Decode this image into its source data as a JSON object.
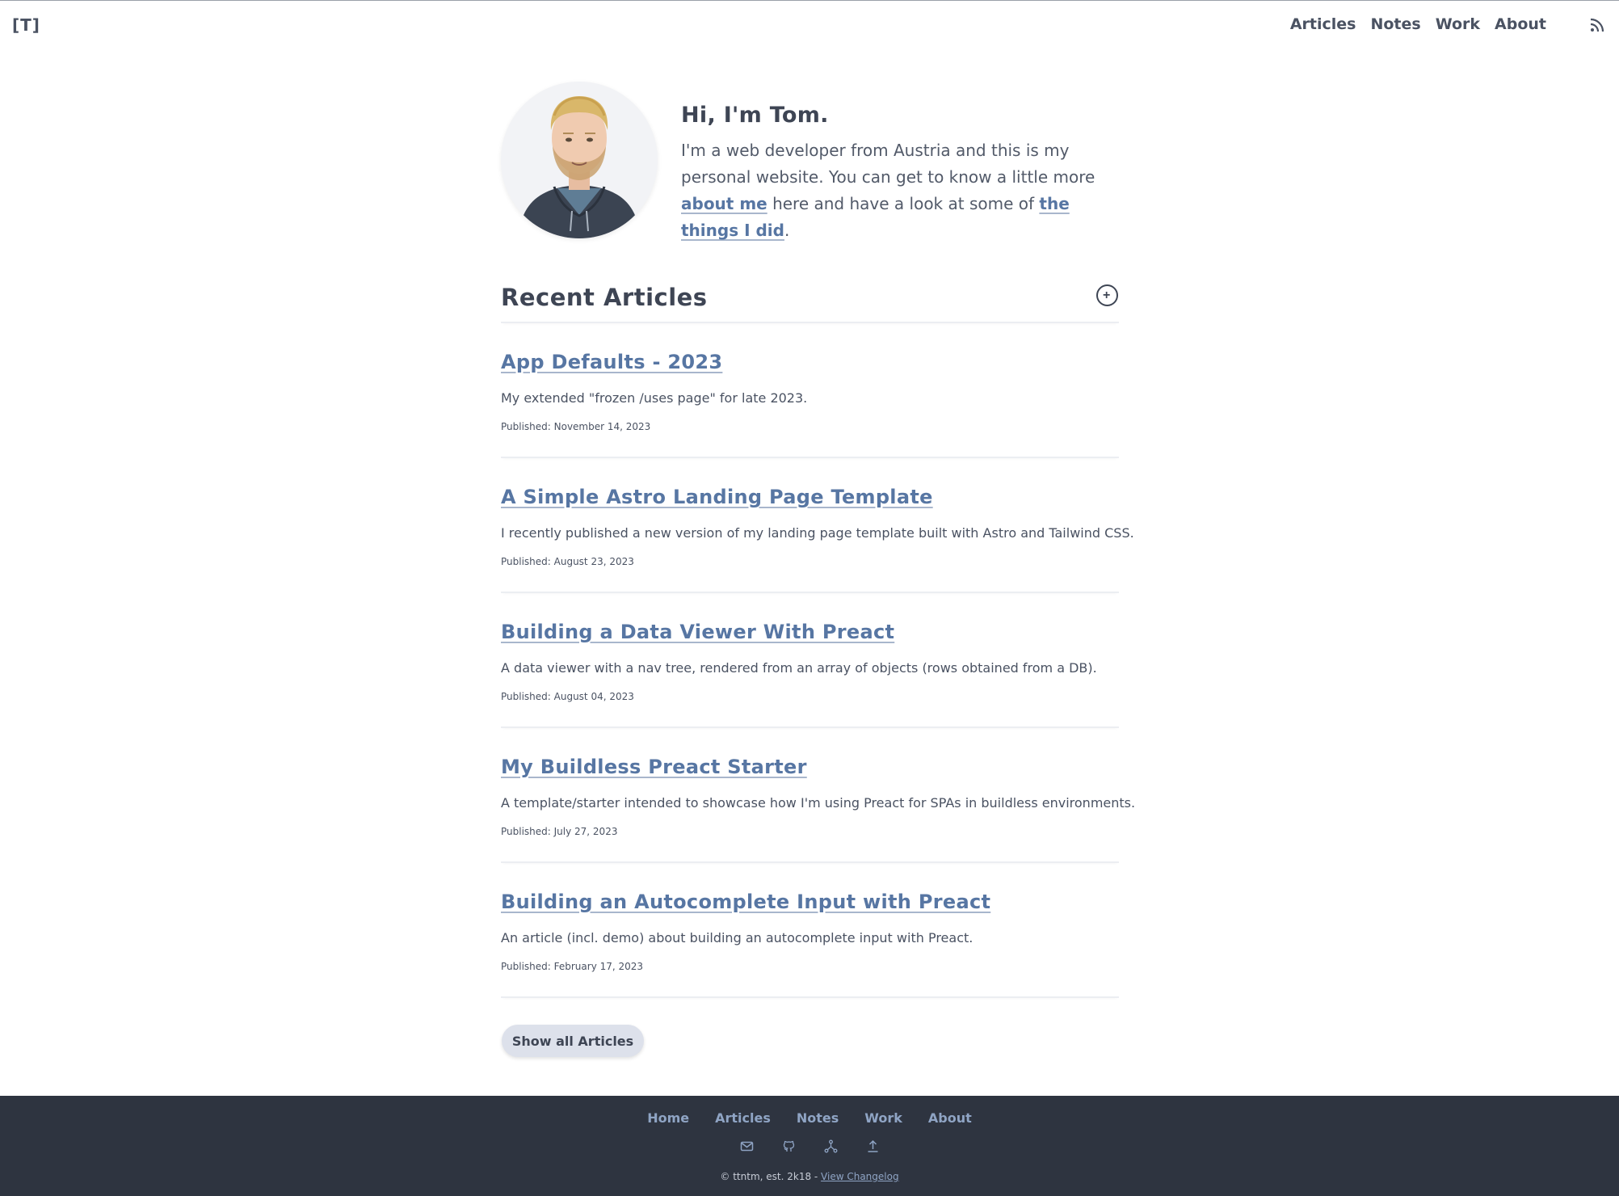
{
  "header": {
    "logo": "[T]",
    "nav": [
      "Articles",
      "Notes",
      "Work",
      "About"
    ]
  },
  "hero": {
    "title": "Hi, I'm Tom.",
    "intro_1": "I'm a web developer from Austria and this is my personal website. You can get to know a little more ",
    "about_link": "about me",
    "intro_2": " here and have a look at some of ",
    "work_link": "the things I did",
    "intro_3": "."
  },
  "articles": {
    "heading": "Recent Articles",
    "items": [
      {
        "title": "App Defaults - 2023",
        "desc": "My extended \"frozen /uses page\" for late 2023.",
        "date": "Published: November 14, 2023"
      },
      {
        "title": "A Simple Astro Landing Page Template",
        "desc": "I recently published a new version of my landing page template built with Astro and Tailwind CSS.",
        "date": "Published: August 23, 2023"
      },
      {
        "title": "Building a Data Viewer With Preact",
        "desc": "A data viewer with a nav tree, rendered from an array of objects (rows obtained from a DB).",
        "date": "Published: August 04, 2023"
      },
      {
        "title": "My Buildless Preact Starter",
        "desc": "A template/starter intended to showcase how I'm using Preact for SPAs in buildless environments.",
        "date": "Published: July 27, 2023"
      },
      {
        "title": "Building an Autocomplete Input with Preact",
        "desc": "An article (incl. demo) about building an autocomplete input with Preact.",
        "date": "Published: February 17, 2023"
      }
    ],
    "show_all": "Show all Articles"
  },
  "footer": {
    "nav": [
      "Home",
      "Articles",
      "Notes",
      "Work",
      "About"
    ],
    "icons": [
      "mail-icon",
      "github-icon",
      "mastodon-icon",
      "scroll-top-icon"
    ],
    "copyright": "© ttntm, est. 2k18 - ",
    "changelog": "View Changelog"
  },
  "colors": {
    "link": "#5776a3",
    "text": "#4a5262",
    "footer_bg": "#2e3440",
    "button_bg": "#dde1eb"
  }
}
